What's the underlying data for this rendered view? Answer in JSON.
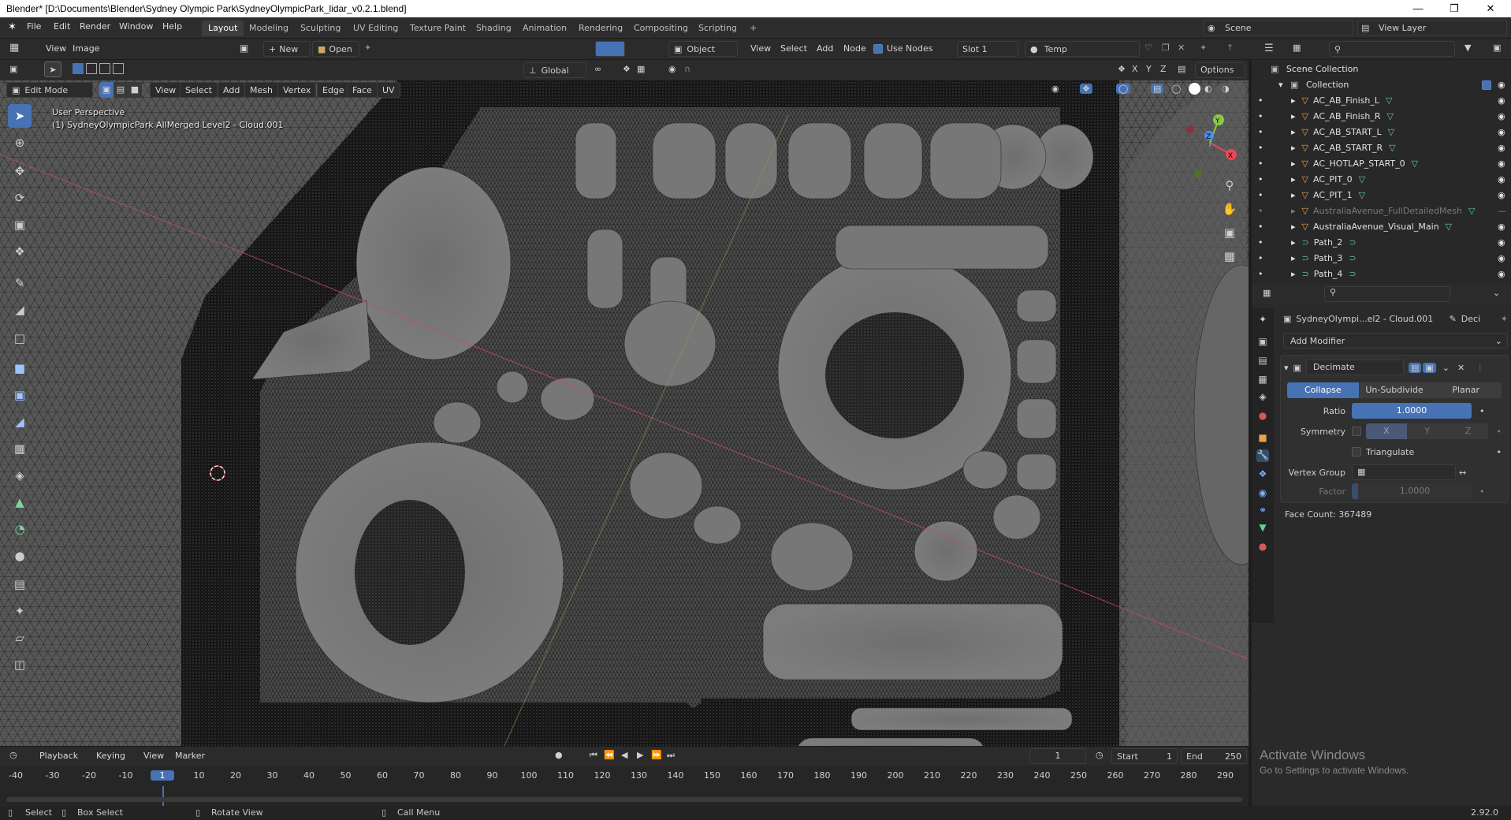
{
  "window": {
    "title": "Blender* [D:\\Documents\\Blender\\Sydney Olympic Park\\SydneyOlympicPark_lidar_v0.2.1.blend]",
    "minimize": "—",
    "maximize": "❐",
    "close": "✕"
  },
  "menu": [
    "File",
    "Edit",
    "Render",
    "Window",
    "Help"
  ],
  "workspaces": [
    "Layout",
    "Modeling",
    "Sculpting",
    "UV Editing",
    "Texture Paint",
    "Shading",
    "Animation",
    "Rendering",
    "Compositing",
    "Scripting"
  ],
  "add_workspace": "+",
  "scene": {
    "name": "Scene",
    "view_layer": "View Layer"
  },
  "image_editor": {
    "menus": [
      "View",
      "Image"
    ],
    "new_label": "New",
    "open_label": "Open"
  },
  "shader_editor": {
    "mode": "Object",
    "menus": [
      "View",
      "Select",
      "Add",
      "Node"
    ],
    "use_nodes_label": "Use Nodes",
    "slot": "Slot 1",
    "material": "Temp"
  },
  "viewport": {
    "mode": "Edit Mode",
    "menus": [
      "View",
      "Select",
      "Add",
      "Mesh",
      "Vertex",
      "Edge",
      "Face",
      "UV"
    ],
    "orientation": "Global",
    "options_label": "Options",
    "axis_labels": [
      "X",
      "Y",
      "Z"
    ],
    "info_line1": "User Perspective",
    "info_line2": "(1) SydneyOlympicPark AllMerged Level2 - Cloud.001"
  },
  "gizmo": {
    "x": "X",
    "y": "Y",
    "z": "Z"
  },
  "outliner": {
    "header": "Scene Collection",
    "collection": "Collection",
    "items": [
      {
        "name": "AC_AB_Finish_L",
        "type": "mesh",
        "dim": false
      },
      {
        "name": "AC_AB_Finish_R",
        "type": "mesh",
        "dim": false
      },
      {
        "name": "AC_AB_START_L",
        "type": "mesh",
        "dim": false
      },
      {
        "name": "AC_AB_START_R",
        "type": "mesh",
        "dim": false
      },
      {
        "name": "AC_HOTLAP_START_0",
        "type": "mesh",
        "dim": false
      },
      {
        "name": "AC_PIT_0",
        "type": "mesh",
        "dim": false
      },
      {
        "name": "AC_PIT_1",
        "type": "mesh",
        "dim": false
      },
      {
        "name": "AustraliaAvenue_FullDetailedMesh",
        "type": "mesh",
        "dim": true
      },
      {
        "name": "AustraliaAvenue_Visual_Main",
        "type": "mesh",
        "dim": false
      },
      {
        "name": "Path_2",
        "type": "curve",
        "dim": false
      },
      {
        "name": "Path_3",
        "type": "curve",
        "dim": false
      },
      {
        "name": "Path_4",
        "type": "curve",
        "dim": false
      }
    ]
  },
  "properties": {
    "object_name": "SydneyOlympi...el2 - Cloud.001",
    "modifier_short": "Deci",
    "add_modifier": "Add Modifier",
    "modifier": {
      "name": "Decimate",
      "tabs": [
        "Collapse",
        "Un-Subdivide",
        "Planar"
      ],
      "active_tab": "Collapse",
      "ratio_label": "Ratio",
      "ratio": "1.0000",
      "ratio_fraction": 1.0,
      "symmetry_label": "Symmetry",
      "symmetry_axes": [
        "X",
        "Y",
        "Z"
      ],
      "triangulate_label": "Triangulate",
      "vertex_group_label": "Vertex Group",
      "factor_label": "Factor",
      "factor": "1.0000",
      "face_count": "Face Count: 367489"
    }
  },
  "timeline": {
    "menus": [
      "Playback",
      "Keying",
      "View",
      "Marker"
    ],
    "current_frame": "1",
    "start_label": "Start",
    "start": "1",
    "end_label": "End",
    "end": "250",
    "ruler": [
      "-40",
      "-30",
      "-20",
      "-10",
      "1",
      "10",
      "20",
      "30",
      "40",
      "50",
      "60",
      "70",
      "80",
      "90",
      "100",
      "110",
      "120",
      "130",
      "140",
      "150",
      "160",
      "170",
      "180",
      "190",
      "200",
      "210",
      "220",
      "230",
      "240",
      "250",
      "260",
      "270",
      "280",
      "290"
    ]
  },
  "activation": {
    "line1": "Activate Windows",
    "line2": "Go to Settings to activate Windows."
  },
  "statusbar": {
    "items": [
      "Select",
      "Box Select",
      "Rotate View",
      "Call Menu"
    ],
    "version": "2.92.0"
  },
  "colors": {
    "accent": "#4772b3",
    "mesh_icon": "#e8a24a",
    "curve_icon": "#5dbf8d",
    "data_icon": "#5ad48a",
    "axis_x": "#e8485a",
    "axis_y": "#8ac847",
    "axis_z": "#4a8ef0"
  }
}
